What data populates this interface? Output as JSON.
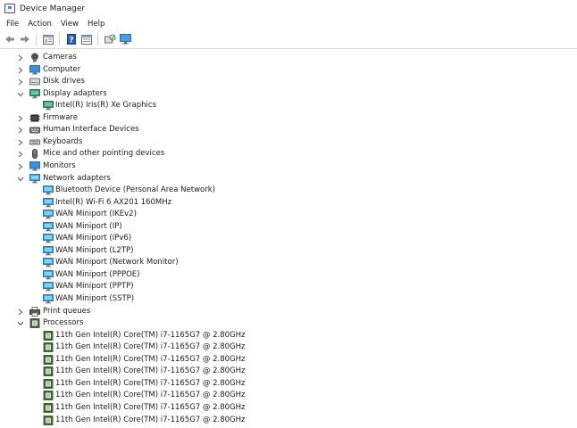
{
  "window": {
    "title": "Device Manager"
  },
  "menu": [
    "File",
    "Action",
    "View",
    "Help"
  ],
  "toolbar": {
    "buttons": [
      {
        "icon": "back-arrow-icon"
      },
      {
        "icon": "forward-arrow-icon"
      },
      {
        "icon": "properties-icon"
      },
      {
        "icon": "help-icon"
      },
      {
        "icon": "device-view-icon"
      },
      {
        "icon": "scan-hardware-icon"
      },
      {
        "icon": "monitor-icon"
      }
    ]
  },
  "tree": [
    {
      "label": "Cameras",
      "level": 0,
      "state": "collapsed",
      "icon": "camera-icon"
    },
    {
      "label": "Computer",
      "level": 0,
      "state": "collapsed",
      "icon": "computer-icon"
    },
    {
      "label": "Disk drives",
      "level": 0,
      "state": "collapsed",
      "icon": "disk-icon"
    },
    {
      "label": "Display adapters",
      "level": 0,
      "state": "expanded",
      "icon": "display-adapter-icon"
    },
    {
      "label": "Intel(R) Iris(R) Xe Graphics",
      "level": 1,
      "state": "leaf",
      "icon": "display-adapter-icon"
    },
    {
      "label": "Firmware",
      "level": 0,
      "state": "collapsed",
      "icon": "firmware-icon"
    },
    {
      "label": "Human Interface Devices",
      "level": 0,
      "state": "collapsed",
      "icon": "hid-icon"
    },
    {
      "label": "Keyboards",
      "level": 0,
      "state": "collapsed",
      "icon": "keyboard-icon"
    },
    {
      "label": "Mice and other pointing devices",
      "level": 0,
      "state": "collapsed",
      "icon": "mouse-icon"
    },
    {
      "label": "Monitors",
      "level": 0,
      "state": "collapsed",
      "icon": "monitor-icon"
    },
    {
      "label": "Network adapters",
      "level": 0,
      "state": "expanded",
      "icon": "network-adapter-icon"
    },
    {
      "label": "Bluetooth Device (Personal Area Network)",
      "level": 1,
      "state": "leaf",
      "icon": "network-adapter-icon"
    },
    {
      "label": "Intel(R) Wi-Fi 6 AX201 160MHz",
      "level": 1,
      "state": "leaf",
      "icon": "network-adapter-icon"
    },
    {
      "label": "WAN Miniport (IKEv2)",
      "level": 1,
      "state": "leaf",
      "icon": "network-adapter-icon"
    },
    {
      "label": "WAN Miniport (IP)",
      "level": 1,
      "state": "leaf",
      "icon": "network-adapter-icon"
    },
    {
      "label": "WAN Miniport (IPv6)",
      "level": 1,
      "state": "leaf",
      "icon": "network-adapter-icon"
    },
    {
      "label": "WAN Miniport (L2TP)",
      "level": 1,
      "state": "leaf",
      "icon": "network-adapter-icon"
    },
    {
      "label": "WAN Miniport (Network Monitor)",
      "level": 1,
      "state": "leaf",
      "icon": "network-adapter-icon"
    },
    {
      "label": "WAN Miniport (PPPOE)",
      "level": 1,
      "state": "leaf",
      "icon": "network-adapter-icon"
    },
    {
      "label": "WAN Miniport (PPTP)",
      "level": 1,
      "state": "leaf",
      "icon": "network-adapter-icon"
    },
    {
      "label": "WAN Miniport (SSTP)",
      "level": 1,
      "state": "leaf",
      "icon": "network-adapter-icon"
    },
    {
      "label": "Print queues",
      "level": 0,
      "state": "collapsed",
      "icon": "printer-icon"
    },
    {
      "label": "Processors",
      "level": 0,
      "state": "expanded",
      "icon": "processor-icon"
    },
    {
      "label": "11th Gen Intel(R) Core(TM) i7-1165G7 @ 2.80GHz",
      "level": 1,
      "state": "leaf",
      "icon": "processor-icon"
    },
    {
      "label": "11th Gen Intel(R) Core(TM) i7-1165G7 @ 2.80GHz",
      "level": 1,
      "state": "leaf",
      "icon": "processor-icon"
    },
    {
      "label": "11th Gen Intel(R) Core(TM) i7-1165G7 @ 2.80GHz",
      "level": 1,
      "state": "leaf",
      "icon": "processor-icon"
    },
    {
      "label": "11th Gen Intel(R) Core(TM) i7-1165G7 @ 2.80GHz",
      "level": 1,
      "state": "leaf",
      "icon": "processor-icon"
    },
    {
      "label": "11th Gen Intel(R) Core(TM) i7-1165G7 @ 2.80GHz",
      "level": 1,
      "state": "leaf",
      "icon": "processor-icon"
    },
    {
      "label": "11th Gen Intel(R) Core(TM) i7-1165G7 @ 2.80GHz",
      "level": 1,
      "state": "leaf",
      "icon": "processor-icon"
    },
    {
      "label": "11th Gen Intel(R) Core(TM) i7-1165G7 @ 2.80GHz",
      "level": 1,
      "state": "leaf",
      "icon": "processor-icon"
    },
    {
      "label": "11th Gen Intel(R) Core(TM) i7-1165G7 @ 2.80GHz",
      "level": 1,
      "state": "leaf",
      "icon": "processor-icon"
    }
  ]
}
